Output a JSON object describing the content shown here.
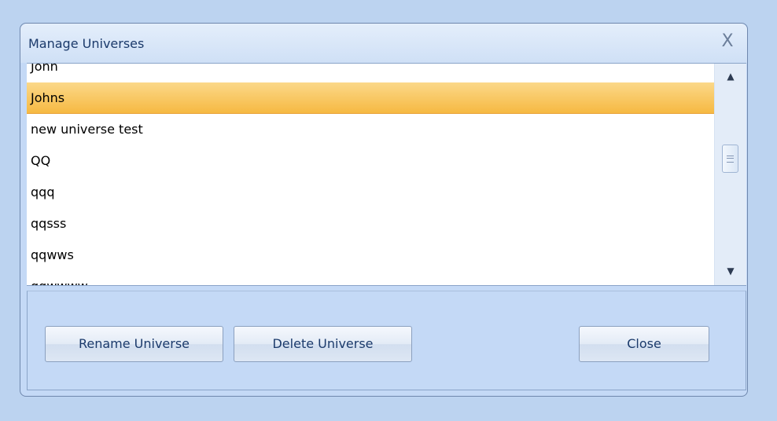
{
  "window": {
    "title": "Manage Universes",
    "close_glyph": "X"
  },
  "list": {
    "items": [
      {
        "label": "John",
        "selected": false
      },
      {
        "label": "Johns",
        "selected": true
      },
      {
        "label": "new universe test",
        "selected": false
      },
      {
        "label": "QQ",
        "selected": false
      },
      {
        "label": "qqq",
        "selected": false
      },
      {
        "label": "qqsss",
        "selected": false
      },
      {
        "label": "qqwws",
        "selected": false
      },
      {
        "label": "qqwwww",
        "selected": false
      }
    ],
    "scroll": {
      "up_glyph": "▲",
      "down_glyph": "▼"
    }
  },
  "buttons": {
    "rename": "Rename Universe",
    "delete": "Delete Universe",
    "close": "Close"
  },
  "colors": {
    "selection": "#f6b942",
    "window_bg": "#c4d9f6",
    "title_text": "#1b3a6b"
  }
}
